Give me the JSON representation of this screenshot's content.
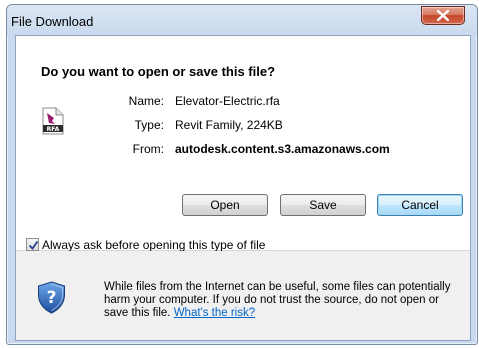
{
  "window": {
    "title": "File Download"
  },
  "dialog": {
    "question": "Do you want to open or save this file?",
    "file_icon_text": "RFA",
    "fields": {
      "name_label": "Name:",
      "name_value": "Elevator-Electric.rfa",
      "type_label": "Type:",
      "type_value": "Revit Family, 224KB",
      "from_label": "From:",
      "from_value": "autodesk.content.s3.amazonaws.com"
    },
    "buttons": {
      "open_label": "Open",
      "save_label": "Save",
      "cancel_label": "Cancel"
    },
    "always_ask": {
      "checked": true,
      "label": "Always ask before opening this type of file"
    },
    "warning": {
      "text": "While files from the Internet can be useful, some files can potentially harm your computer. If you do not trust the source, do not open or save this file.",
      "link": "What's the risk?"
    }
  },
  "icons": {
    "close": "close-icon",
    "file": "rfa-file-icon",
    "shield": "security-shield-icon",
    "checkmark": "checkmark-icon"
  },
  "colors": {
    "close_button": "#c4462a",
    "link": "#0066cc",
    "default_button_border": "#3c7fb1",
    "titlebar": "#cad9ee"
  }
}
